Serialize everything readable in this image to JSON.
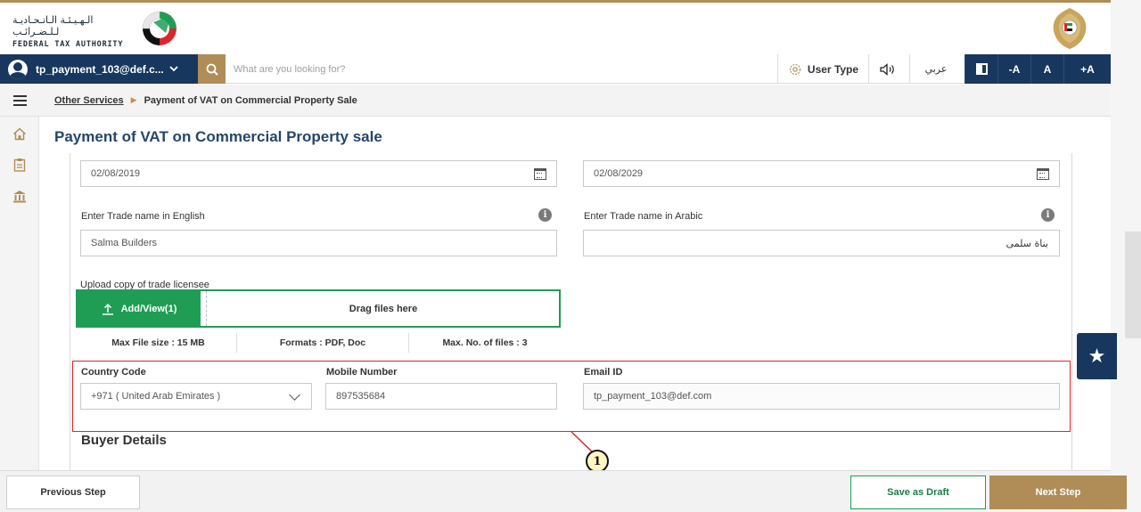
{
  "header": {
    "logo_ar": "الـهـيـئـة الـاتـحـاديـة لـلـضـرائـب",
    "logo_en": "FEDERAL TAX AUTHORITY"
  },
  "toolbar": {
    "user_name": "tp_payment_103@def.c...",
    "search_placeholder": "What are you looking for?",
    "user_type_label": "User Type",
    "language_label": "عربي",
    "font_decrease": "-A",
    "font_normal": "A",
    "font_increase": "+A"
  },
  "breadcrumb": {
    "parent": "Other Services",
    "current": "Payment of VAT on Commercial Property Sale"
  },
  "page": {
    "title": "Payment of VAT on Commercial Property sale"
  },
  "form": {
    "date_start": "02/08/2019",
    "date_end": "02/08/2029",
    "trade_name_en_label": "Enter Trade name in English",
    "trade_name_en_value": "Salma Builders",
    "trade_name_ar_label": "Enter Trade name in Arabic",
    "trade_name_ar_value": "بناة سلمى",
    "upload_label": "Upload copy of trade licensee",
    "upload_button": "Add/View(1)",
    "drag_text": "Drag files here",
    "max_file_size": "Max File size : 15 MB",
    "formats": "Formats : PDF, Doc",
    "max_files": "Max. No. of files : 3",
    "country_code_label": "Country Code",
    "country_code_value": "+971 ( United Arab Emirates )",
    "mobile_label": "Mobile Number",
    "mobile_value": "897535684",
    "email_label": "Email ID",
    "email_value": "tp_payment_103@def.com",
    "buyer_section_title": "Buyer Details"
  },
  "annotation": {
    "callout_number": "1",
    "highlight_color": "#d9272e"
  },
  "footer": {
    "previous_label": "Previous Step",
    "draft_label": "Save as Draft",
    "next_label": "Next Step"
  },
  "colors": {
    "navy": "#17375e",
    "gold": "#b08d57",
    "green": "#1f9d55",
    "title_blue": "#25466b"
  },
  "icons": {
    "user": "user-circle-icon",
    "search": "search-icon",
    "settings": "gear-icon",
    "speaker": "speaker-icon",
    "contrast": "contrast-icon",
    "menu": "hamburger-icon",
    "home": "home-icon",
    "clipboard": "clipboard-icon",
    "bank": "bank-icon",
    "calendar": "calendar-icon",
    "info": "info-icon",
    "upload": "upload-arrow-icon",
    "chevron": "chevron-down-icon",
    "star": "star-icon"
  }
}
